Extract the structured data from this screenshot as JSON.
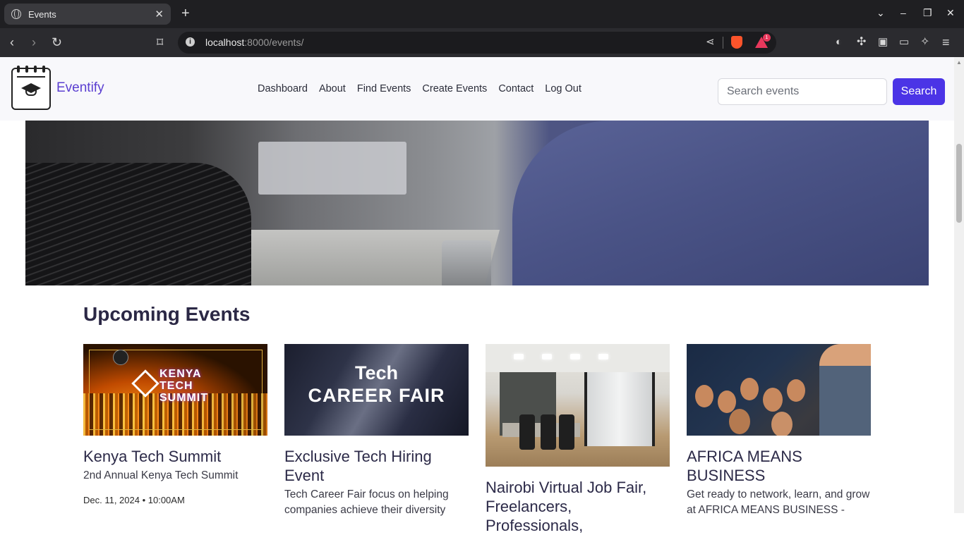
{
  "browser": {
    "tab_title": "Events",
    "url_host": "localhost",
    "url_rest": ":8000/events/"
  },
  "icons": {
    "back": "back-arrow-icon",
    "forward": "forward-arrow-icon",
    "reload": "reload-icon",
    "bookmark": "bookmark-icon",
    "share": "share-icon",
    "brave": "brave-shield-icon",
    "rewards": "brave-rewards-icon",
    "rewards_count": "1"
  },
  "site": {
    "brand": "Eventify",
    "nav": [
      "Dashboard",
      "About",
      "Find Events",
      "Create Events",
      "Contact",
      "Log Out"
    ],
    "search_placeholder": "Search events",
    "search_button": "Search"
  },
  "main": {
    "section_title": "Upcoming Events",
    "events": [
      {
        "title": "Kenya Tech Summit",
        "subtitle": "2nd Annual Kenya Tech Summit",
        "date": "Dec. 11, 2024 • 10:00AM",
        "image_text": [
          "KENYA",
          "TECH",
          "SUMMIT"
        ]
      },
      {
        "title": "Exclusive Tech Hiring Event",
        "subtitle": "Tech Career Fair focus on helping companies achieve their diversity",
        "image_text": [
          "Tech",
          "CAREER FAIR"
        ]
      },
      {
        "title": "Nairobi Virtual Job Fair, Freelancers, Professionals,"
      },
      {
        "title": "AFRICA MEANS BUSINESS",
        "subtitle": "Get ready to network, learn, and grow at AFRICA MEANS BUSINESS -"
      }
    ]
  },
  "colors": {
    "brand": "#5b3fd1",
    "primary_button": "#4b34e6",
    "heading": "#2b2845"
  }
}
